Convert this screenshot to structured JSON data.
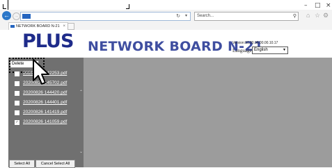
{
  "window": {
    "minimize": "–",
    "maximize": "□",
    "close": "×"
  },
  "address_bar": {
    "value": "",
    "refresh_icon": "refresh-icon",
    "dropdown_icon": "chevron-down-icon"
  },
  "search": {
    "placeholder": "Search...",
    "icon": "search-icon"
  },
  "toolbar_icons": [
    "home-icon",
    "star-icon",
    "gear-icon"
  ],
  "tab": {
    "label": "NETWORK BOARD N-21",
    "close": "×"
  },
  "header": {
    "logo": "PLUS",
    "title": "NETWORK BOARD N-21",
    "version": "Version:01.00.00.00.00.10.17",
    "language_label": "Language",
    "language_value": "English"
  },
  "file_panel": {
    "action_select": "Delete",
    "files": [
      {
        "name": "20200826 142253.pdf",
        "checked": false
      },
      {
        "name": "20200826 145702.pdf",
        "checked": false
      },
      {
        "name": "20200826 144420.pdf",
        "checked": false
      },
      {
        "name": "20200826 144401.pdf",
        "checked": false
      },
      {
        "name": "20200826 141419.pdf",
        "checked": false
      },
      {
        "name": "20200826 141059.pdf",
        "checked": true
      }
    ],
    "select_all": "Select All",
    "cancel_select_all": "Cancel Select All"
  },
  "colors": {
    "logo": "#1e2b8a",
    "title": "#3f4ea0",
    "sidebar": "#707070",
    "main_area": "#9c9c9c",
    "browser_accent": "#2b77c9"
  }
}
